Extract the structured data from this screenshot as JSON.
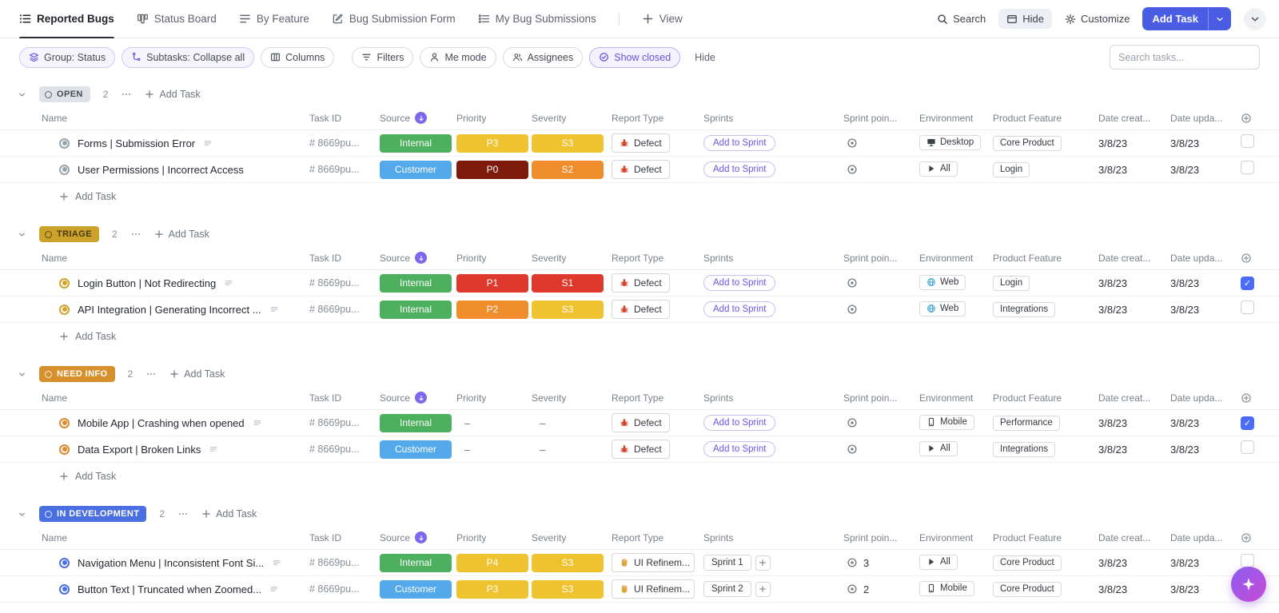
{
  "palette": {
    "accent": "#4a5be4",
    "green": "#4db05f",
    "blue": "#54a9eb",
    "yellow": "#eec32f",
    "orange": "#ef8c2b",
    "red": "#df382c",
    "darkred": "#7d1a0a",
    "gold": "#cda22b",
    "statusOrange": "#d8902c",
    "statusBlue": "#4a6fe0",
    "purple": "#7b68ee"
  },
  "topnav": {
    "tabs": [
      {
        "label": "Reported Bugs"
      },
      {
        "label": "Status Board"
      },
      {
        "label": "By Feature"
      },
      {
        "label": "Bug Submission Form"
      },
      {
        "label": "My Bug Submissions"
      }
    ],
    "view": "View",
    "search": "Search",
    "hide": "Hide",
    "customize": "Customize",
    "add_task": "Add Task"
  },
  "toolbar": {
    "group": "Group: Status",
    "subtasks": "Subtasks: Collapse all",
    "columns": "Columns",
    "filters": "Filters",
    "me_mode": "Me mode",
    "assignees": "Assignees",
    "show_closed": "Show closed",
    "hide": "Hide",
    "search_placeholder": "Search tasks..."
  },
  "table": {
    "headers": {
      "name": "Name",
      "task_id": "Task ID",
      "source": "Source",
      "priority": "Priority",
      "severity": "Severity",
      "report_type": "Report Type",
      "sprints": "Sprints",
      "sprint_points": "Sprint poin...",
      "environment": "Environment",
      "product_feature": "Product Feature",
      "date_created": "Date creat...",
      "date_updated": "Date upda..."
    }
  },
  "labels": {
    "add_task": "Add Task",
    "add_to_sprint": "Add to Sprint"
  },
  "groups": [
    {
      "status": "OPEN",
      "count": "2",
      "tasks": [
        {
          "name": "Forms | Submission Error",
          "task_id": "# 8669pu...",
          "source": "Internal",
          "priority": "P3",
          "severity": "S3",
          "report_type": "Defect",
          "report_type_icon": "bug",
          "sprint": "Add to Sprint",
          "sprint_points": "",
          "environment": "Desktop",
          "environment_icon": "monitor",
          "product_feature": "Core Product",
          "date_created": "3/8/23",
          "date_updated": "3/8/23",
          "checked": false
        },
        {
          "name": "User Permissions | Incorrect Access",
          "task_id": "# 8669pu...",
          "source": "Customer",
          "priority": "P0",
          "severity": "S2",
          "report_type": "Defect",
          "report_type_icon": "bug",
          "sprint": "Add to Sprint",
          "sprint_points": "",
          "environment": "All",
          "environment_icon": "play",
          "product_feature": "Login",
          "date_created": "3/8/23",
          "date_updated": "3/8/23",
          "checked": false
        }
      ]
    },
    {
      "status": "TRIAGE",
      "count": "2",
      "tasks": [
        {
          "name": "Login Button | Not Redirecting",
          "task_id": "# 8669pu...",
          "source": "Internal",
          "priority": "P1",
          "severity": "S1",
          "report_type": "Defect",
          "report_type_icon": "bug",
          "sprint": "Add to Sprint",
          "sprint_points": "",
          "environment": "Web",
          "environment_icon": "globe",
          "product_feature": "Login",
          "date_created": "3/8/23",
          "date_updated": "3/8/23",
          "checked": true
        },
        {
          "name": "API Integration | Generating Incorrect ...",
          "task_id": "# 8669pu...",
          "source": "Internal",
          "priority": "P2",
          "severity": "S3",
          "report_type": "Defect",
          "report_type_icon": "bug",
          "sprint": "Add to Sprint",
          "sprint_points": "",
          "environment": "Web",
          "environment_icon": "globe",
          "product_feature": "Integrations",
          "date_created": "3/8/23",
          "date_updated": "3/8/23",
          "checked": false
        }
      ]
    },
    {
      "status": "NEED INFO",
      "count": "2",
      "tasks": [
        {
          "name": "Mobile App | Crashing when opened",
          "task_id": "# 8669pu...",
          "source": "Internal",
          "priority": "–",
          "severity": "–",
          "report_type": "Defect",
          "report_type_icon": "bug",
          "sprint": "Add to Sprint",
          "sprint_points": "",
          "environment": "Mobile",
          "environment_icon": "phone",
          "product_feature": "Performance",
          "date_created": "3/8/23",
          "date_updated": "3/8/23",
          "checked": true
        },
        {
          "name": "Data Export | Broken Links",
          "task_id": "# 8669pu...",
          "source": "Customer",
          "priority": "–",
          "severity": "–",
          "report_type": "Defect",
          "report_type_icon": "bug",
          "sprint": "Add to Sprint",
          "sprint_points": "",
          "environment": "All",
          "environment_icon": "play",
          "product_feature": "Integrations",
          "date_created": "3/8/23",
          "date_updated": "3/8/23",
          "checked": false
        }
      ]
    },
    {
      "status": "IN DEVELOPMENT",
      "count": "2",
      "tasks": [
        {
          "name": "Navigation Menu | Inconsistent Font Si...",
          "task_id": "# 8669pu...",
          "source": "Internal",
          "priority": "P4",
          "severity": "S3",
          "report_type": "UI Refinem...",
          "report_type_icon": "hand",
          "sprint": "Sprint 1",
          "sprint_points": "3",
          "environment": "All",
          "environment_icon": "play",
          "product_feature": "Core Product",
          "date_created": "3/8/23",
          "date_updated": "3/8/23",
          "checked": false
        },
        {
          "name": "Button Text | Truncated when Zoomed...",
          "task_id": "# 8669pu...",
          "source": "Customer",
          "priority": "P3",
          "severity": "S3",
          "report_type": "UI Refinem...",
          "report_type_icon": "hand",
          "sprint": "Sprint 2",
          "sprint_points": "2",
          "environment": "Mobile",
          "environment_icon": "phone",
          "product_feature": "Core Product",
          "date_created": "3/8/23",
          "date_updated": "3/8/23",
          "checked": true
        }
      ]
    }
  ]
}
